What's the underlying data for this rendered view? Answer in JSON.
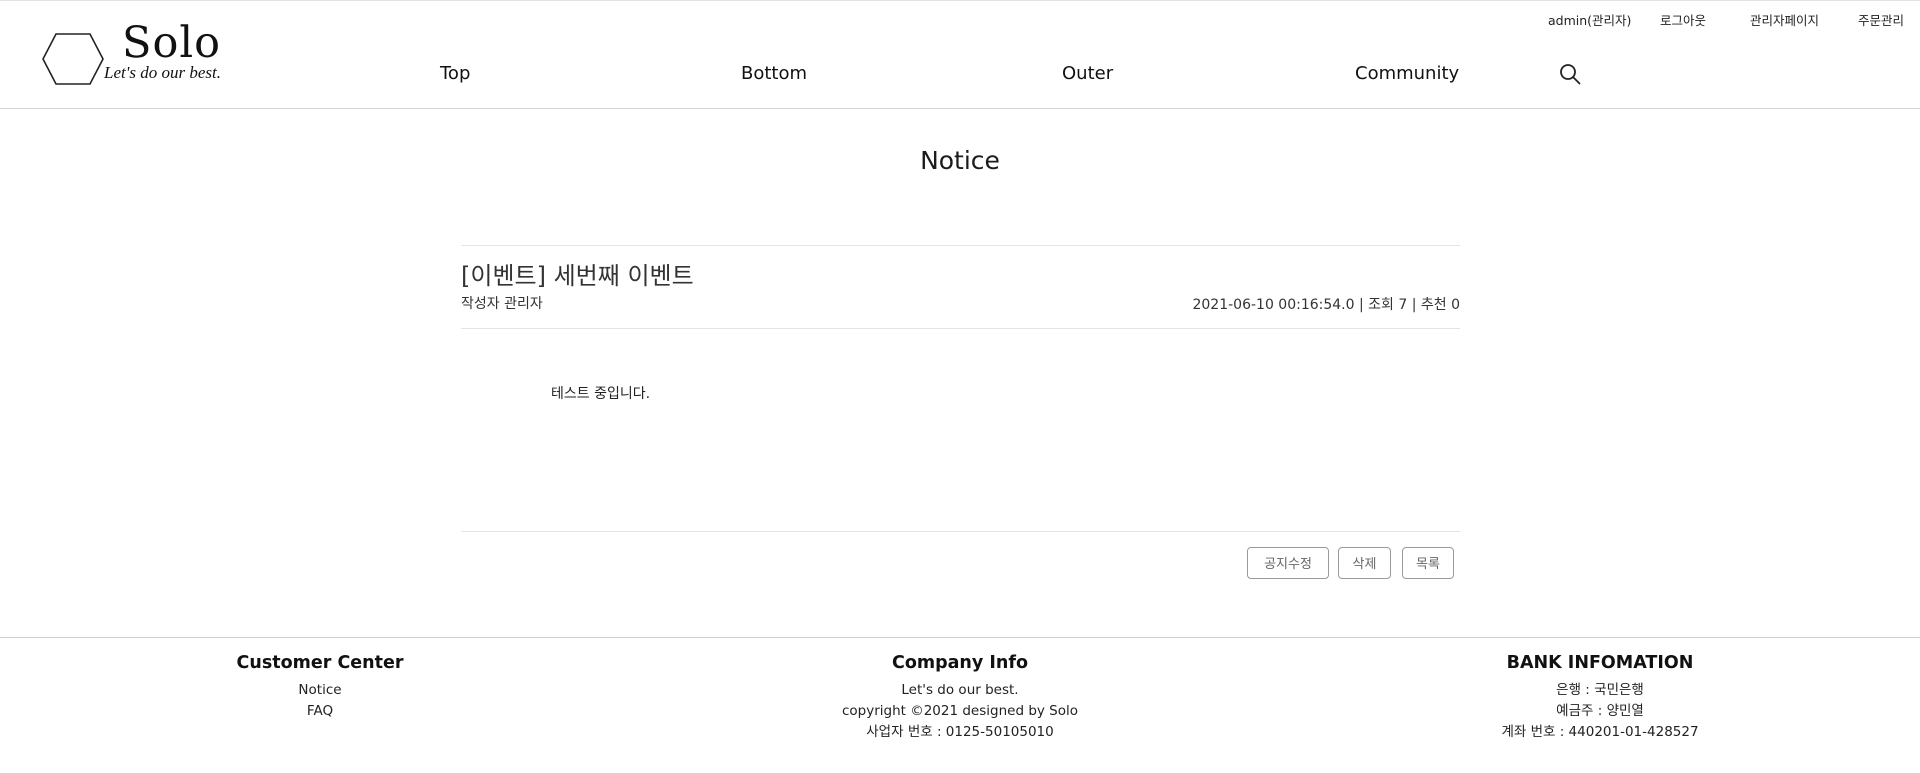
{
  "header": {
    "logo": {
      "word": "Solo",
      "tagline": "Let's do our best."
    },
    "utility": {
      "user": "admin(관리자)",
      "logout": "로그아웃",
      "admin_page": "관리자페이지",
      "order_manage": "주문관리"
    },
    "nav": [
      "Top",
      "Bottom",
      "Outer",
      "Community"
    ],
    "search_icon": "search-icon"
  },
  "page": {
    "title": "Notice"
  },
  "post": {
    "title": "[이벤트] 세번째 이벤트",
    "author": "작성자 관리자",
    "meta": "2021-06-10 00:16:54.0 | 조회 7 | 추천 0",
    "body": "테스트 중입니다."
  },
  "actions": {
    "edit": "공지수정",
    "delete": "삭제",
    "list": "목록"
  },
  "footer": {
    "customer": {
      "heading": "Customer Center",
      "links": [
        "Notice",
        "FAQ"
      ]
    },
    "company": {
      "heading": "Company Info",
      "lines": [
        "Let's do our best.",
        "copyright ©2021 designed by Solo",
        "사업자 번호 : 0125-50105010"
      ]
    },
    "bank": {
      "heading": "BANK INFOMATION",
      "lines": [
        "은행 : 국민은행",
        "예금주 : 양민열",
        "계좌 번호 : 440201-01-428527"
      ]
    }
  }
}
